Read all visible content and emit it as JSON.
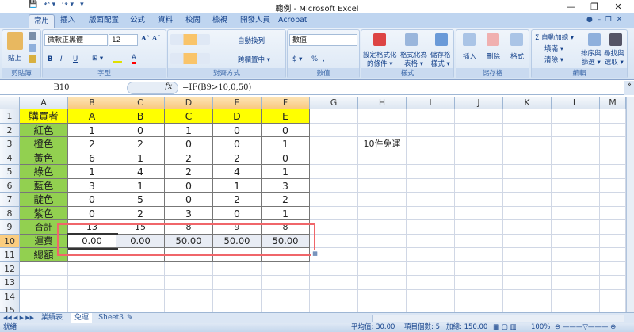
{
  "window": {
    "title": "範例 - Microsoft Excel",
    "minimize": "—",
    "restore": "❐",
    "close": "✕"
  },
  "qat": [
    "💾",
    "↶ ▾",
    "↷ ▾",
    "▾"
  ],
  "tabs": [
    "常用",
    "插入",
    "版面配置",
    "公式",
    "資料",
    "校閱",
    "檢視",
    "開發人員",
    "Acrobat"
  ],
  "ribbon": {
    "clipboard": {
      "label": "剪貼簿",
      "paste": "貼上"
    },
    "font": {
      "label": "字型",
      "name": "微軟正黑體",
      "size": "12",
      "bold": "B",
      "italic": "I",
      "underline": "U"
    },
    "alignment": {
      "label": "對齊方式",
      "wrap": "自動換列",
      "merge": "跨欄置中 ▾"
    },
    "number": {
      "label": "數值",
      "format": "數值",
      "currency": "$ ▾",
      "percent": "%",
      "comma": ","
    },
    "styles": {
      "label": "樣式",
      "conditional": "設定格式化\n的條件 ▾",
      "table": "格式化為\n表格 ▾",
      "cell": "儲存格\n樣式 ▾"
    },
    "cells": {
      "label": "儲存格",
      "insert": "插入",
      "delete": "刪除",
      "format": "格式"
    },
    "editing": {
      "label": "編輯",
      "autosum": "Σ 自動加總 ▾",
      "fill": "填滿 ▾",
      "clear": "清除 ▾",
      "sort": "排序與\n篩選 ▾",
      "find": "尋找與\n選取 ▾"
    }
  },
  "formula_bar": {
    "name_box": "B10",
    "fx": "fx",
    "formula": "=IF(B9>10,0,50)"
  },
  "columns": [
    "A",
    "B",
    "C",
    "D",
    "E",
    "F",
    "G",
    "H",
    "I",
    "J",
    "K",
    "L",
    "M"
  ],
  "rows": [
    "1",
    "2",
    "3",
    "4",
    "5",
    "6",
    "7",
    "8",
    "9",
    "10",
    "11",
    "12",
    "13",
    "14",
    "15"
  ],
  "selected_cell": "B10",
  "table": [
    [
      "購買者",
      "A",
      "B",
      "C",
      "D",
      "E"
    ],
    [
      "紅色",
      "1",
      "0",
      "1",
      "0",
      "0"
    ],
    [
      "橙色",
      "2",
      "2",
      "0",
      "0",
      "1"
    ],
    [
      "黃色",
      "6",
      "1",
      "2",
      "2",
      "0"
    ],
    [
      "綠色",
      "1",
      "4",
      "2",
      "4",
      "1"
    ],
    [
      "藍色",
      "3",
      "1",
      "0",
      "1",
      "3"
    ],
    [
      "靛色",
      "0",
      "5",
      "0",
      "2",
      "2"
    ],
    [
      "紫色",
      "0",
      "2",
      "3",
      "0",
      "1"
    ],
    [
      "合計",
      "13",
      "15",
      "8",
      "9",
      "8"
    ],
    [
      "運費",
      "0.00",
      "0.00",
      "50.00",
      "50.00",
      "50.00"
    ],
    [
      "總額",
      "",
      "",
      "",
      "",
      ""
    ]
  ],
  "note": {
    "cell": "H3",
    "text": "10件免運"
  },
  "colors": {
    "header_yellow": "#ffff00",
    "label_green": "#92d050",
    "highlight": "#f0666a",
    "selection": "#e8ecf4"
  },
  "sheet_tabs": [
    "業績表",
    "免運",
    "Sheet3"
  ],
  "active_sheet": "免運",
  "status": {
    "ready": "就緒",
    "average": "平均值: 30.00",
    "count": "項目個數: 5",
    "sum": "加總: 150.00",
    "zoom": "100%"
  }
}
